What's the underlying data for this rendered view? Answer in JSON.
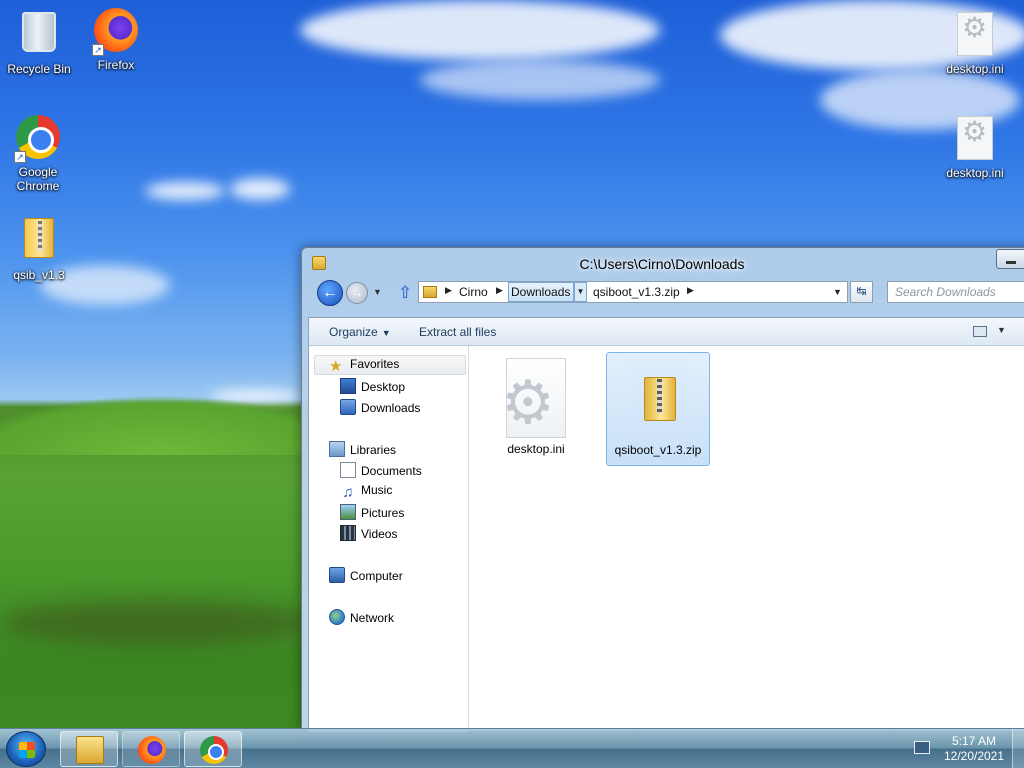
{
  "desktop": {
    "icons": [
      {
        "label": "Recycle Bin",
        "icon": "recycle-bin-icon"
      },
      {
        "label": "Firefox",
        "icon": "firefox-icon"
      },
      {
        "label": "Google Chrome",
        "icon": "chrome-icon"
      },
      {
        "label": "qsib_v1.3",
        "icon": "zip-folder-icon"
      },
      {
        "label": "desktop.ini",
        "icon": "settings-file-icon"
      },
      {
        "label": "desktop.ini",
        "icon": "settings-file-icon"
      }
    ]
  },
  "window": {
    "title": "C:\\Users\\Cirno\\Downloads",
    "breadcrumb": [
      "Cirno",
      "Downloads",
      "qsiboot_v1.3.zip"
    ],
    "search_placeholder": "Search Downloads",
    "toolbar": {
      "organize": "Organize",
      "extract": "Extract all files"
    },
    "nav": {
      "favorites": "Favorites",
      "favorites_items": [
        "Desktop",
        "Downloads"
      ],
      "libraries": "Libraries",
      "libraries_items": [
        "Documents",
        "Music",
        "Pictures",
        "Videos"
      ],
      "computer": "Computer",
      "network": "Network"
    },
    "files": [
      {
        "name": "desktop.ini",
        "selected": false
      },
      {
        "name": "qsiboot_v1.3.zip",
        "selected": true
      }
    ]
  },
  "taskbar": {
    "time": "5:17 AM",
    "date": "12/20/2021"
  }
}
